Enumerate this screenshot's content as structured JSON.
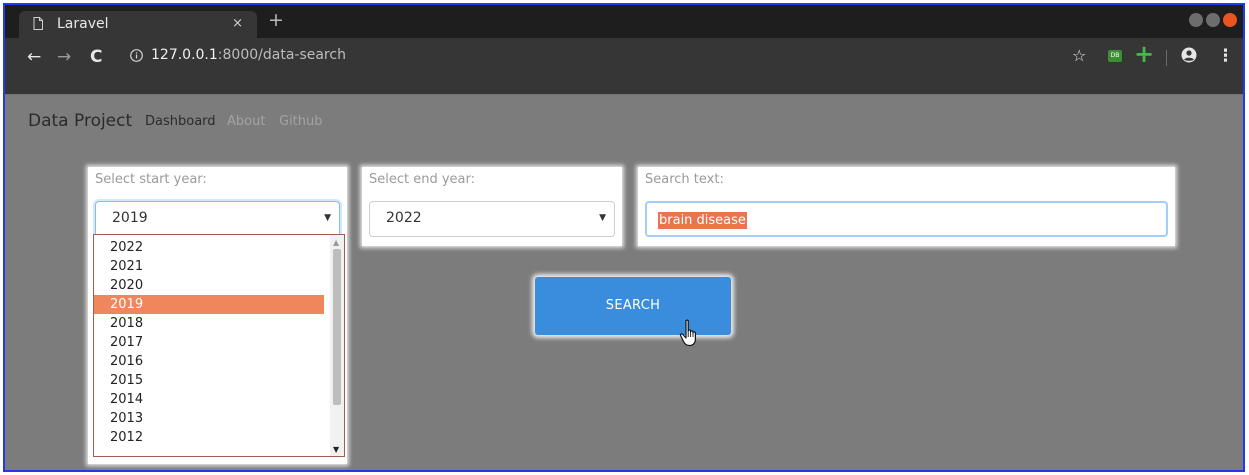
{
  "browser": {
    "tab_title": "Laravel",
    "tab_close": "×",
    "new_tab": "+",
    "nav": {
      "back": "←",
      "forward": "→",
      "reload": "C"
    },
    "url_host": "127.0.0.1",
    "url_path": ":8000/data-search",
    "star": "☆",
    "extension_label": "DB",
    "plus": "+",
    "menu": "⋮"
  },
  "navbar": {
    "brand": "Data Project",
    "links": [
      "Dashboard",
      "About",
      "Github"
    ]
  },
  "form": {
    "start_year": {
      "label": "Select start year:",
      "value": "2019"
    },
    "end_year": {
      "label": "Select end year:",
      "value": "2022"
    },
    "search": {
      "label": "Search text:",
      "value": "brain disease"
    },
    "dropdown_options": [
      "2022",
      "2021",
      "2020",
      "2019",
      "2018",
      "2017",
      "2016",
      "2015",
      "2014",
      "2013",
      "2012"
    ],
    "dropdown_selected": "2019",
    "select_arrow": "▼",
    "search_button": "SEARCH"
  },
  "colors": {
    "frame_border": "#1f3ce6",
    "accent_button": "#3a8ddc",
    "selection": "#f0865b",
    "window_close": "#e95420"
  },
  "icons": [
    "file-icon",
    "info-icon",
    "star-icon",
    "database-icon",
    "plus-icon",
    "profile-icon",
    "menu-icon",
    "hand-cursor-icon"
  ]
}
